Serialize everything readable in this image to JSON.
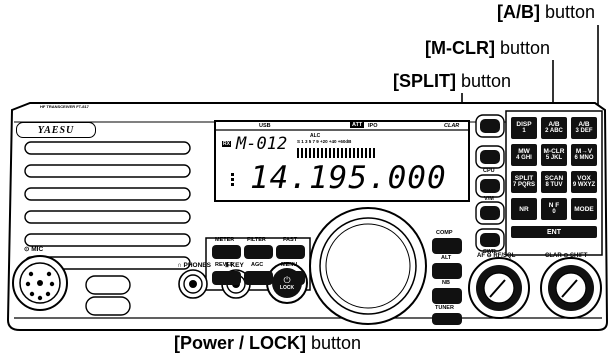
{
  "callouts": {
    "ab": {
      "bracket": "[A/B]",
      "word": " button"
    },
    "mclr": {
      "bracket": "[M-CLR]",
      "word": " button"
    },
    "split": {
      "bracket": "[SPLIT]",
      "word": " button"
    },
    "power": {
      "bracket": "[Power / LOCK]",
      "word": " button"
    }
  },
  "radio": {
    "brand": "YAESU",
    "model_text": "HF TRANSCEIVER FT-817",
    "mic_label": "MIC",
    "phones_label": "PHONES",
    "key_label": "KEY",
    "lock_label": "LOCK",
    "af_label": "AF",
    "rf_label": "RF/SQL",
    "clar_label": "CLAR",
    "shift_label": "SHIFT",
    "lcd": {
      "usb": "USB",
      "att": "ATT",
      "ipo": "IPO",
      "clar": "CLAR",
      "alc": "ALC",
      "rx": "RX",
      "channel": "M-012",
      "frequency": "14.195.000",
      "scale": "S 1 3 5 7 9 +20 +40 +60dB"
    },
    "left_buttons": [
      "METER",
      "FILTER",
      "FAST",
      "REVER",
      "AGC",
      "MENU"
    ],
    "side_labels": [
      "CPU",
      "V/M",
      "SWR"
    ],
    "right_labels": [
      "COMP",
      "ALT",
      "NB",
      "TUNER"
    ],
    "keypad": [
      {
        "top": "DISP",
        "sub": "1",
        "name": "disp"
      },
      {
        "top": "A/B",
        "sub": "2 ABC",
        "name": "ab-top"
      },
      {
        "top": "A/B",
        "sub": "3 DEF",
        "name": "ab"
      },
      {
        "top": "MW",
        "sub": "4 GHI",
        "name": "mw"
      },
      {
        "top": "M-CLR",
        "sub": "5 JKL",
        "name": "mclr"
      },
      {
        "top": "M→V",
        "sub": "6 MNO",
        "name": "mv"
      },
      {
        "top": "SPLIT",
        "sub": "7 PQRS",
        "name": "split"
      },
      {
        "top": "SCAN",
        "sub": "8 TUV",
        "name": "scan"
      },
      {
        "top": "VOX",
        "sub": "9 WXYZ",
        "name": "vox"
      },
      {
        "top": "NR",
        "sub": "",
        "name": "nr"
      },
      {
        "top": "N F",
        "sub": "0",
        "name": "nf"
      },
      {
        "top": "MODE",
        "sub": "",
        "name": "mode"
      }
    ],
    "ent_label": "ENT"
  }
}
